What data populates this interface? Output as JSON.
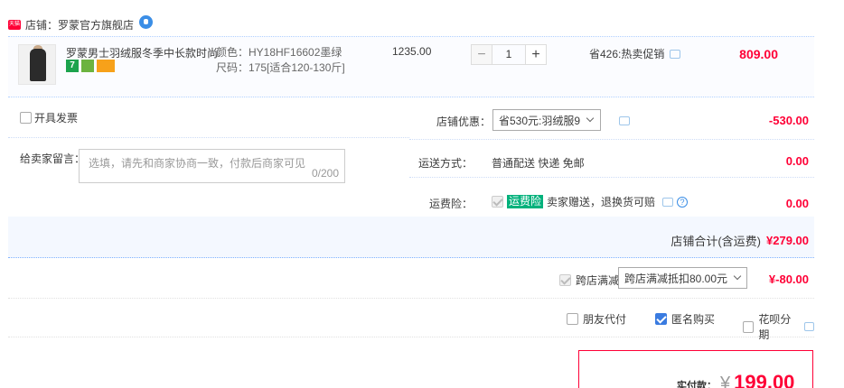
{
  "store": {
    "icon_text": "天猫",
    "name": "店铺：罗蒙官方旗舰店"
  },
  "item": {
    "title": "罗蒙男士羽绒服冬季中长款时尚...",
    "badges": [
      "7",
      "",
      ""
    ],
    "sku_color": "颜色：HY18HF16602墨绿",
    "sku_size": "尺码：175[适合120-130斤]",
    "unit_price": "1235.00",
    "quantity": "1",
    "minus": "−",
    "plus": "+",
    "promo": "省426:热卖促销",
    "total": "809.00"
  },
  "invoice": {
    "label": "开具发票"
  },
  "message": {
    "label": "给卖家留言：",
    "placeholder": "选填，请先和商家协商一致，付款后商家可见",
    "counter": "0/200"
  },
  "discount": {
    "label": "店铺优惠：",
    "selected": "省530元:羽绒服9",
    "amount": "-530.00"
  },
  "shipping": {
    "label": "运送方式：",
    "method": "普通配送 快递 免邮",
    "amount": "0.00"
  },
  "insurance": {
    "label": "运费险：",
    "tag": "运费险",
    "text": "卖家赠送，退换货可赔",
    "help": "?",
    "amount": "0.00"
  },
  "store_total": {
    "label": "店铺合计(含运费)",
    "amount": "¥279.00"
  },
  "cross_store": {
    "label": "跨店满减",
    "selected": "跨店满减抵扣80.00元",
    "amount": "¥-80.00"
  },
  "options": {
    "friend_pay": "朋友代付",
    "anonymous": "匿名购买",
    "huabei": "花呗分期"
  },
  "payment": {
    "label": "实付款：",
    "currency": "¥",
    "amount": "199.00"
  },
  "colors": {
    "accent_red": "#ff0036",
    "blue_border": "#b2d1ff",
    "panel_bg": "#f4f8ff",
    "insurance_green": "#00b17b"
  }
}
